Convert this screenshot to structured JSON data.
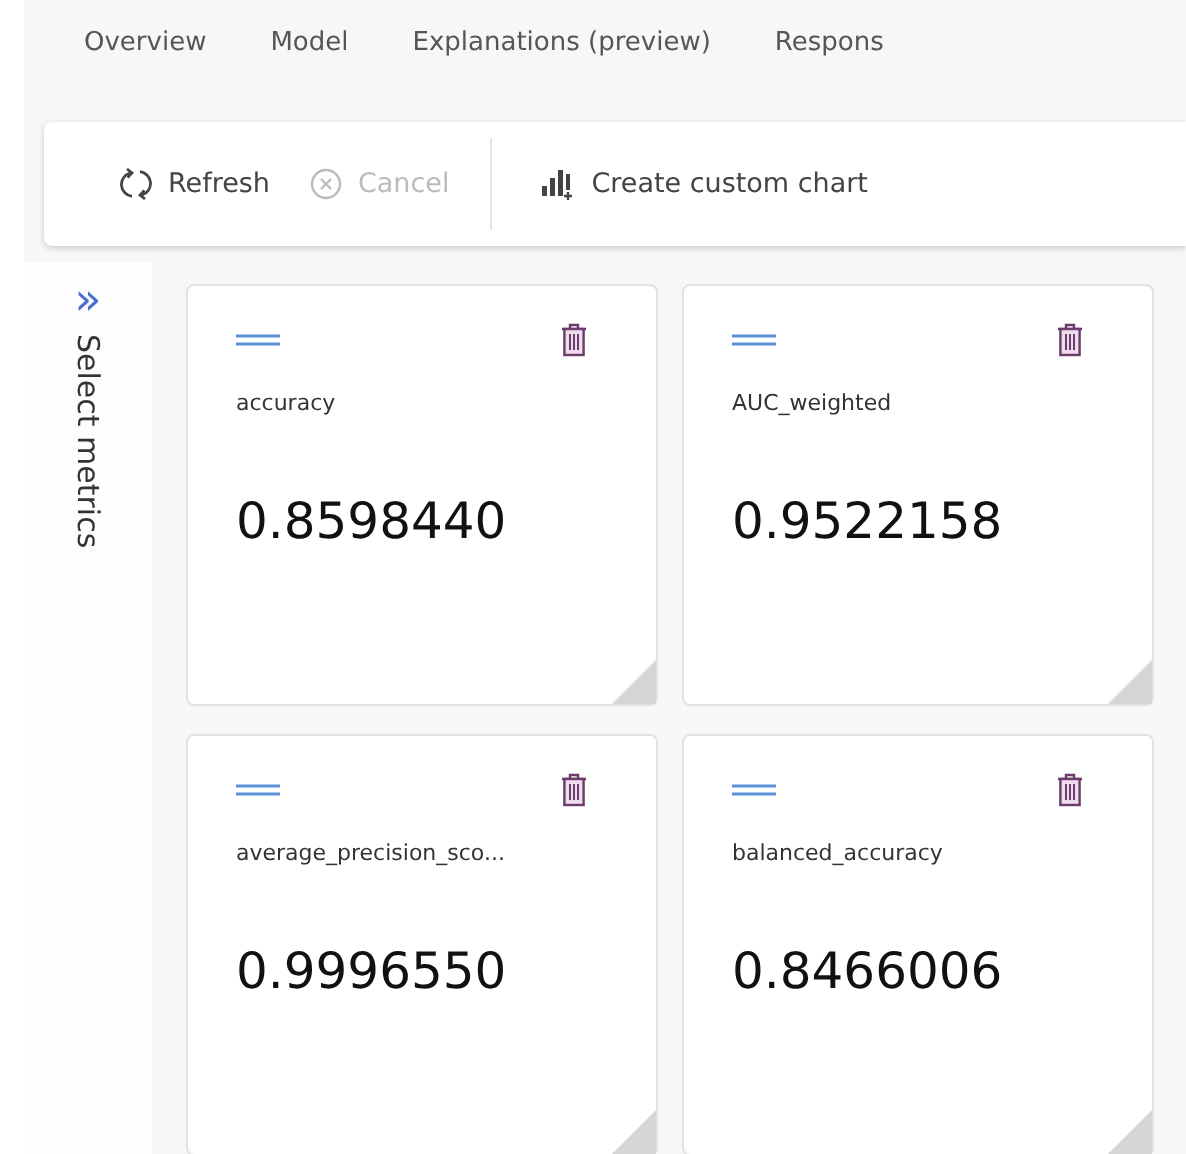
{
  "tabs": [
    {
      "label": "Overview",
      "selected": false
    },
    {
      "label": "Model",
      "selected": false
    },
    {
      "label": "Explanations (preview)",
      "selected": false
    },
    {
      "label": "Respons",
      "selected": false
    }
  ],
  "toolbar": [
    {
      "kind": "refresh",
      "label": "Refresh",
      "disabled": false
    },
    {
      "kind": "cancel",
      "label": "Cancel",
      "disabled": true
    },
    {
      "kind": "chart",
      "label": "Create custom chart",
      "disabled": false
    }
  ],
  "side_panel": {
    "label": "Select metrics",
    "expand_glyph": "»"
  },
  "metrics": [
    {
      "name": "accuracy",
      "value": "0.8598440"
    },
    {
      "name": "AUC_weighted",
      "value": "0.9522158"
    },
    {
      "name": "average_precision_sco...",
      "value": "0.9996550"
    },
    {
      "name": "balanced_accuracy",
      "value": "0.8466006"
    }
  ]
}
